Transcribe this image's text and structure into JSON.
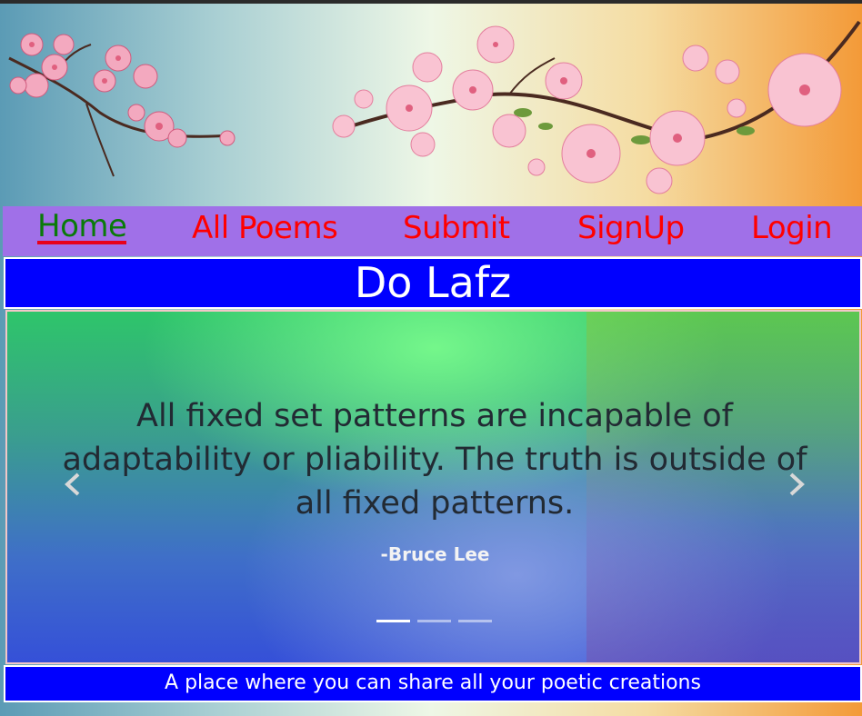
{
  "nav": {
    "items": [
      {
        "label": "Home",
        "active": true
      },
      {
        "label": "All Poems",
        "active": false
      },
      {
        "label": "Submit",
        "active": false
      },
      {
        "label": "SignUp",
        "active": false
      },
      {
        "label": "Login",
        "active": false
      }
    ]
  },
  "site": {
    "title": "Do Lafz",
    "tagline": "A place where you can share all your poetic creations"
  },
  "carousel": {
    "quote": "All fixed set patterns are incapable of adaptability or pliability. The truth is outside of all fixed patterns.",
    "author": "-Bruce Lee",
    "prev_icon": "chevron-left-icon",
    "next_icon": "chevron-right-icon",
    "indicator_count": 3,
    "active_index": 0
  },
  "colors": {
    "nav_bg": "#a070e8",
    "nav_link": "#ff0000",
    "nav_active": "#0a7a0a",
    "title_bg": "#0000ff",
    "footer_bg": "#0000ff"
  }
}
